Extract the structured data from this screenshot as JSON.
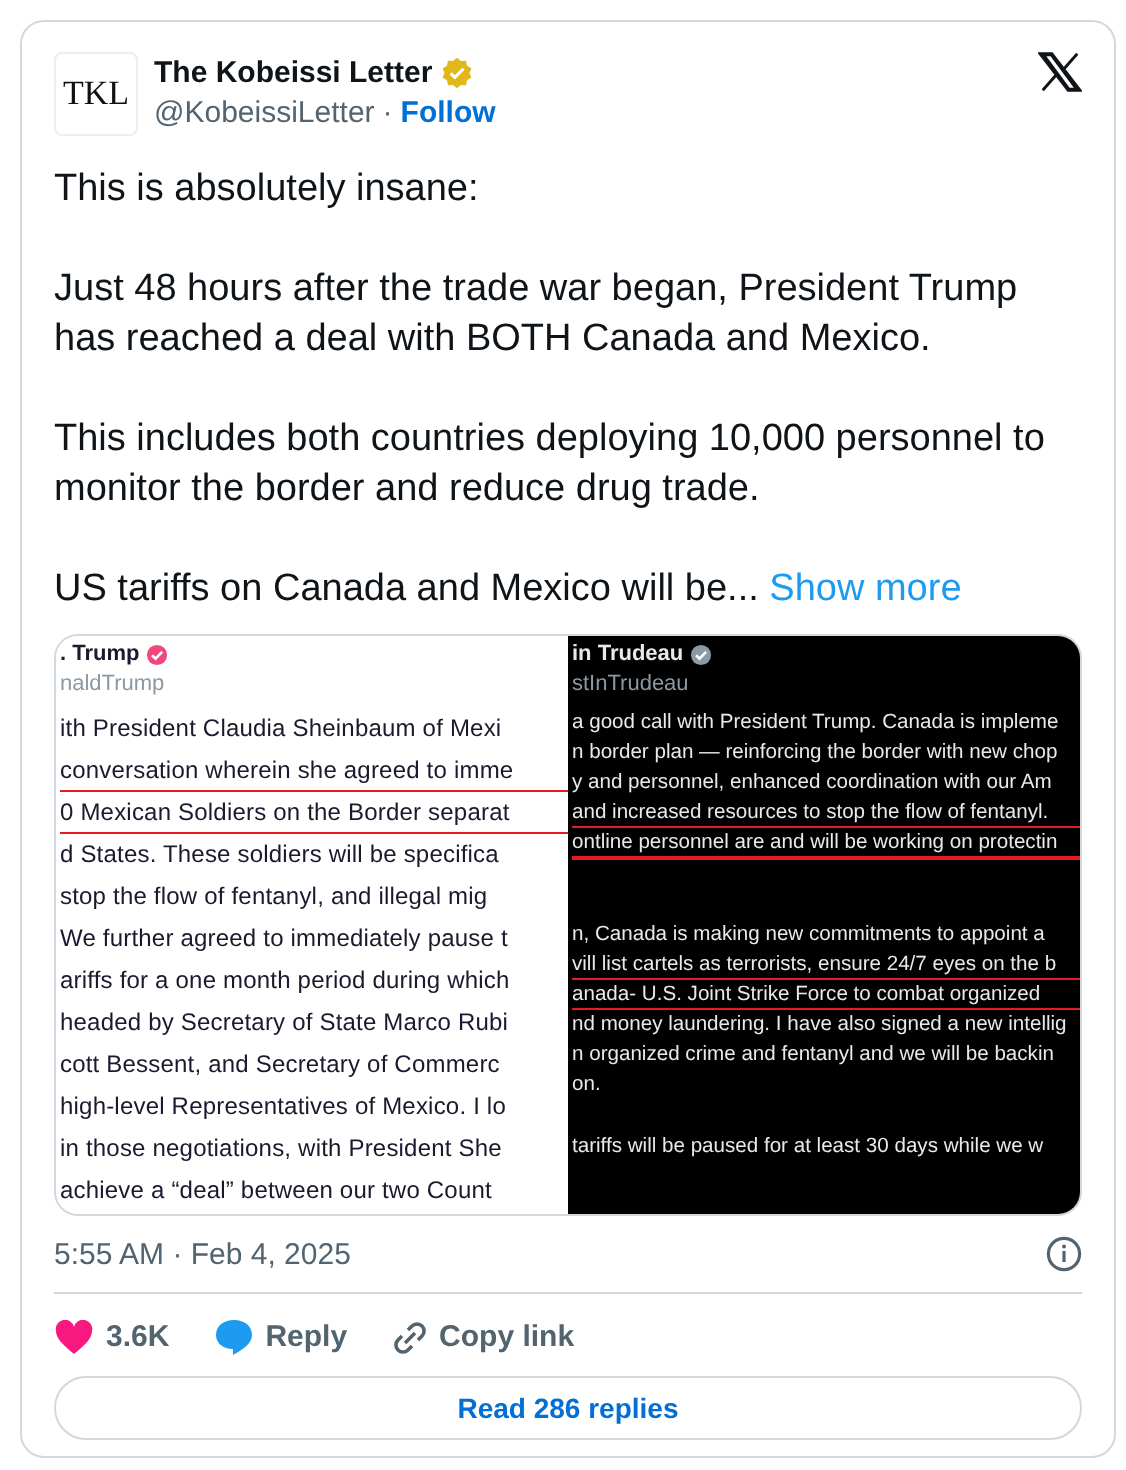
{
  "author": {
    "avatar_text": "TKL",
    "name": "The Kobeissi Letter",
    "verified": true,
    "handle": "@KobeissiLetter",
    "separator": "·",
    "follow": "Follow"
  },
  "paragraphs": [
    "This is absolutely insane:",
    "Just 48 hours after the trade war began, President Trump has reached a deal with BOTH Canada and Mexico.",
    "This includes both countries deploying 10,000 personnel to monitor the border and reduce drug trade."
  ],
  "last_paragraph": {
    "text": "US tariffs on Canada and Mexico will be...",
    "show_more": "Show more"
  },
  "media": [
    {
      "kind": "light",
      "name": ". Trump",
      "handle": "naldTrump",
      "lines": [
        {
          "text": "ith President Claudia Sheinbaum of Mexi",
          "underlined": false
        },
        {
          "text": "conversation wherein she agreed to imme",
          "underlined": true
        },
        {
          "text": "0 Mexican Soldiers on the Border separat",
          "underlined": true
        },
        {
          "text": "d States. These soldiers will be specifica",
          "underlined": false
        },
        {
          "text": "stop the flow of fentanyl, and illegal mig",
          "underlined": false
        },
        {
          "text": "We further agreed to immediately pause t",
          "underlined": false
        },
        {
          "text": "ariffs for a one month period during which",
          "underlined": false
        },
        {
          "text": "headed by Secretary of State Marco Rubi",
          "underlined": false
        },
        {
          "text": "cott Bessent, and Secretary of Commerc",
          "underlined": false
        },
        {
          "text": "high-level Representatives of Mexico. I lo",
          "underlined": false
        },
        {
          "text": "in those negotiations, with President She",
          "underlined": false
        },
        {
          "text": "achieve a “deal” between our two Count",
          "underlined": false
        }
      ]
    },
    {
      "kind": "dark",
      "name": "in Trudeau",
      "handle": "stInTrudeau",
      "lines": [
        {
          "text": "a good call with President Trump. Canada is impleme",
          "underlined": false
        },
        {
          "text": "n border plan — reinforcing the border with new chop",
          "underlined": false
        },
        {
          "text": "y and personnel, enhanced coordination with our Am",
          "underlined": false
        },
        {
          "text": "and increased resources to stop the flow of fentanyl.",
          "underlined": true
        },
        {
          "text": "ontline personnel are and will be working on protectin",
          "underlined": true,
          "gap_after": true
        },
        {
          "text": "n, Canada is making new commitments to appoint a",
          "underlined": false
        },
        {
          "text": "vill list cartels as terrorists, ensure 24/7 eyes on the b",
          "underlined": true
        },
        {
          "text": "anada- U.S. Joint Strike Force to combat organized",
          "underlined": true
        },
        {
          "text": "nd money laundering. I have also signed a new intellig",
          "underlined": false
        },
        {
          "text": "n organized crime and fentanyl and we will be backin",
          "underlined": false
        },
        {
          "text": "on.",
          "underlined": false,
          "gap_after": true
        },
        {
          "text": "tariffs will be paused for at least 30 days while we w",
          "underlined": false
        }
      ]
    }
  ],
  "timestamp": "5:55 AM · Feb 4, 2025",
  "actions": [
    {
      "kind": "like",
      "label": "3.6K"
    },
    {
      "kind": "reply",
      "label": "Reply"
    },
    {
      "kind": "copy",
      "label": "Copy link"
    }
  ],
  "read_replies": "Read 286 replies"
}
